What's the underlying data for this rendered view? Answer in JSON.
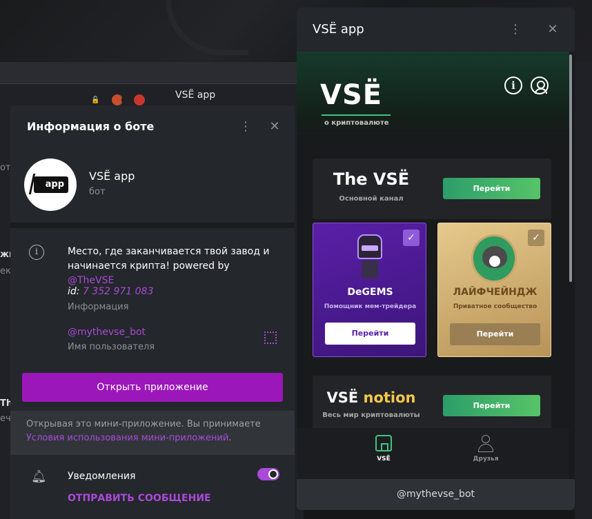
{
  "background": {
    "chat_title": "VSË app",
    "side_texts": [
      "от",
      "жка",
      "екс",
      "Th",
      "еч"
    ]
  },
  "bot_info": {
    "header_title": "Информация о боте",
    "bot_name": "VSË app",
    "bot_type": "бот",
    "avatar_text": "app",
    "description_main": "Место, где заканчивается твой завод и начинается крипта! powered by ",
    "description_link": "@TheVSE",
    "id_prefix": "id: ",
    "id_value": "7 352 971 083",
    "id_label": "Информация",
    "username": "@mythevse_bot",
    "username_label": "Имя пользователя",
    "open_button": "Открыть приложение",
    "terms_text": "Открывая это мини-приложение. Вы принимаете ",
    "terms_link": "Условия использования мини-приложений",
    "terms_end": ".",
    "notifications_label": "Уведомления",
    "notifications_on": true,
    "send_message": "ОТПРАВИТЬ СООБЩЕНИЕ"
  },
  "mini_app": {
    "window_title": "VSË app",
    "hero_logo": "VSË",
    "hero_sub": "о криптовалюте",
    "cards": {
      "channel": {
        "title": "The VSË",
        "subtitle": "Основной канал",
        "button": "Перейти"
      },
      "degems": {
        "title": "DeGEMS",
        "subtitle": "Помощник мем-трейдера",
        "button": "Перейти",
        "checked": true
      },
      "life": {
        "title": "ЛАЙФЧЕЙНДЖ",
        "subtitle": "Приватное сообщество",
        "button": "Перейти",
        "checked": true
      },
      "notion": {
        "title_a": "VSË ",
        "title_b": "notion",
        "subtitle": "Весь мир криптовалюты",
        "button": "Перейти"
      }
    },
    "nav": [
      {
        "label": "VSË",
        "active": true
      },
      {
        "label": "Друзья",
        "active": false
      }
    ],
    "footer": "@mythevse_bot"
  },
  "colors": {
    "accent_purple": "#9c17ba",
    "link_purple": "#a94ad9",
    "green": "#3fc584"
  }
}
